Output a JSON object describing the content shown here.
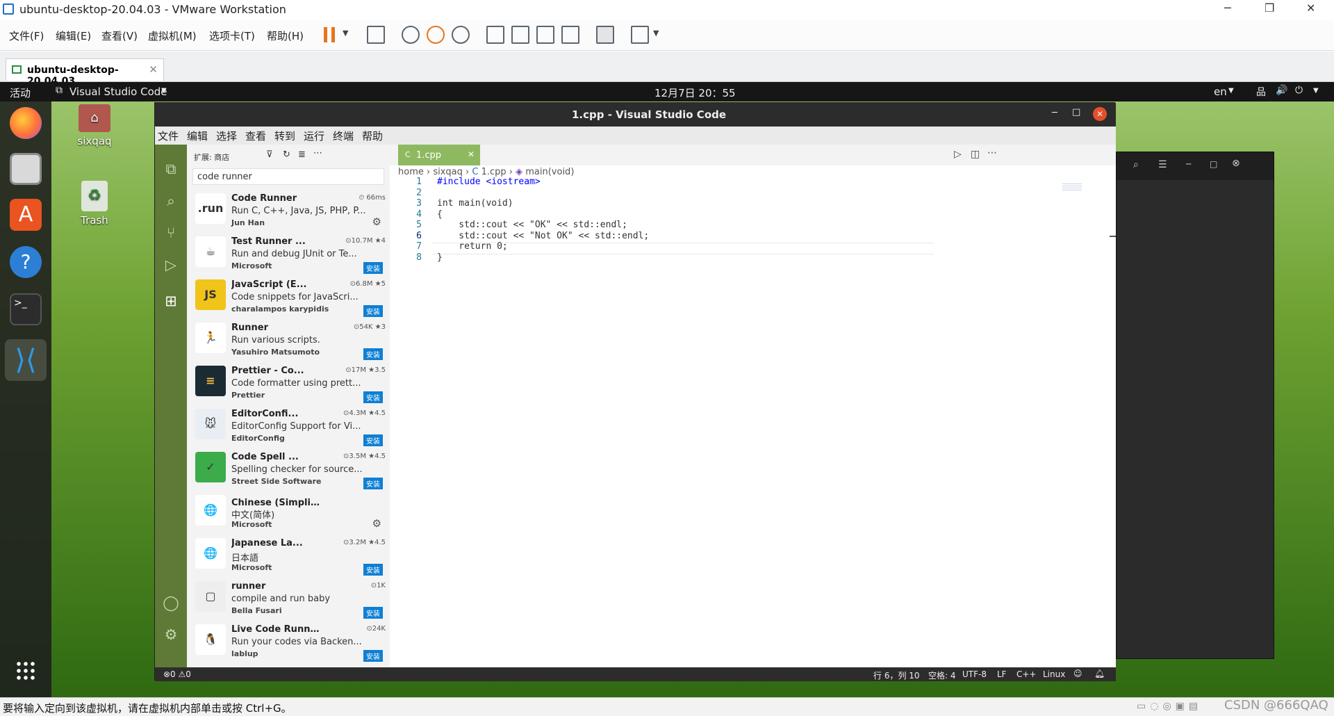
{
  "vmware": {
    "title": "ubuntu-desktop-20.04.03 - VMware Workstation",
    "menu": [
      "文件(F)",
      "编辑(E)",
      "查看(V)",
      "虚拟机(M)",
      "选项卡(T)",
      "帮助(H)"
    ],
    "tab": "ubuntu-desktop-20.04.03",
    "status": "要将输入定向到该虚拟机，请在虚拟机内部单击或按 Ctrl+G。",
    "watermark": "CSDN @666QAQ"
  },
  "gnome": {
    "activities": "活动",
    "app": "Visual Studio Code",
    "clock": "12月7日  20：55",
    "lang": "en"
  },
  "desktop": {
    "home_label": "sixqaq",
    "trash_label": "Trash"
  },
  "vscode": {
    "title": "1.cpp - Visual Studio Code",
    "menu": [
      "文件",
      "编辑",
      "选择",
      "查看",
      "转到",
      "运行",
      "终端",
      "帮助"
    ],
    "sidebar": {
      "header": "扩展: 商店",
      "search_value": "code runner",
      "extensions": [
        {
          "name": "Code Runner",
          "stats": "⏲ 66ms",
          "desc": "Run C, C++, Java, JS, PHP, P...",
          "publisher": "Jun Han",
          "action": "gear",
          "icon": ".run",
          "color": "#fff"
        },
        {
          "name": "Test Runner ...",
          "stats": "⊙10.7M ★4",
          "desc": "Run and debug JUnit or Te...",
          "publisher": "Microsoft",
          "action": "安装",
          "icon": "☕",
          "color": "#fff"
        },
        {
          "name": "JavaScript (E...",
          "stats": "⊙6.8M ★5",
          "desc": "Code snippets for JavaScri...",
          "publisher": "charalampos karypidis",
          "action": "安装",
          "icon": "JS",
          "color": "#f0c419"
        },
        {
          "name": "Runner",
          "stats": "⊙54K ★3",
          "desc": "Run various scripts.",
          "publisher": "Yasuhiro Matsumoto",
          "action": "安装",
          "icon": "🏃",
          "color": "#fff"
        },
        {
          "name": "Prettier - Co...",
          "stats": "⊙17M ★3.5",
          "desc": "Code formatter using prett...",
          "publisher": "Prettier",
          "action": "安装",
          "icon": "≡",
          "color": "#1a2b34"
        },
        {
          "name": "EditorConfi...",
          "stats": "⊙4.3M ★4.5",
          "desc": "EditorConfig Support for Vi...",
          "publisher": "EditorConfig",
          "action": "安装",
          "icon": "🐭",
          "color": "#e8eef3"
        },
        {
          "name": "Code Spell ...",
          "stats": "⊙3.5M ★4.5",
          "desc": "Spelling checker for source...",
          "publisher": "Street Side Software",
          "action": "安装",
          "icon": "✓",
          "color": "#3cab4a"
        },
        {
          "name": "Chinese (Simplified) (简...",
          "stats": "",
          "desc": "中文(简体)",
          "publisher": "Microsoft",
          "action": "gear",
          "icon": "🌐",
          "color": "#fff"
        },
        {
          "name": "Japanese La...",
          "stats": "⊙3.2M ★4.5",
          "desc": "日本語",
          "publisher": "Microsoft",
          "action": "安装",
          "icon": "🌐",
          "color": "#fff"
        },
        {
          "name": "runner",
          "stats": "⊙1K",
          "desc": "compile and run baby",
          "publisher": "Bella Fusari",
          "action": "安装",
          "icon": "▢",
          "color": "#eee"
        },
        {
          "name": "Live Code Runner",
          "stats": "⊙24K",
          "desc": "Run your codes via Backen...",
          "publisher": "lablup",
          "action": "安装",
          "icon": "🐧",
          "color": "#fff"
        }
      ]
    },
    "tab": "1.cpp",
    "breadcrumb": [
      "home",
      "sixqaq",
      "1.cpp",
      "main(void)"
    ],
    "code": [
      {
        "n": "1",
        "t": "#include <iostream>"
      },
      {
        "n": "2",
        "t": ""
      },
      {
        "n": "3",
        "t": "int main(void)"
      },
      {
        "n": "4",
        "t": "{"
      },
      {
        "n": "5",
        "t": "    std::cout << \"OK\" << std::endl;"
      },
      {
        "n": "6",
        "t": "    std::cout << \"Not OK\" << std::endl;"
      },
      {
        "n": "7",
        "t": "    return 0;"
      },
      {
        "n": "8",
        "t": "}"
      }
    ],
    "status": {
      "problems": "⊗0 ⚠0",
      "position": "行 6，列 10",
      "spaces": "空格: 4",
      "encoding": "UTF-8",
      "eol": "LF",
      "lang": "C++",
      "os": "Linux"
    }
  }
}
